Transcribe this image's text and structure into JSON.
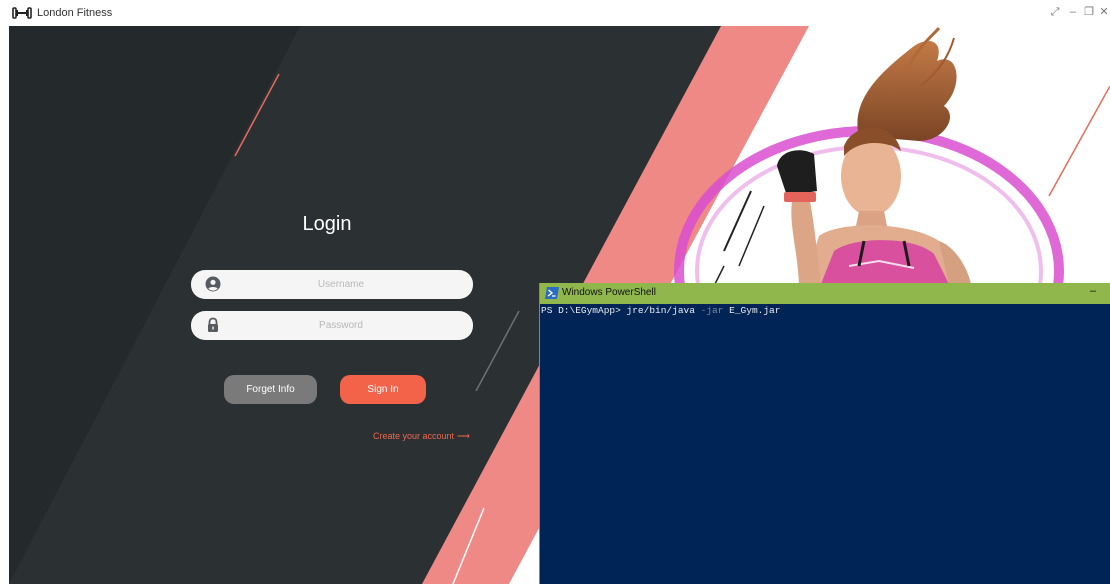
{
  "window": {
    "title": "London Fitness",
    "logo_icon": "dumbbell-icon",
    "controls": [
      {
        "name": "expand-icon",
        "glyph": "⤢"
      },
      {
        "name": "minimize-icon",
        "glyph": "–"
      },
      {
        "name": "restore-icon",
        "glyph": "❐"
      },
      {
        "name": "close-icon",
        "glyph": "✕"
      }
    ]
  },
  "login": {
    "title": "Login",
    "username_placeholder": "Username",
    "password_placeholder": "Password",
    "username_icon": "user-icon",
    "password_icon": "lock-icon",
    "forget_label": "Forget Info",
    "signin_label": "Sign In",
    "create_label": "Create your account",
    "create_arrow": "⟶"
  },
  "colors": {
    "dark_panel": "#2b3033",
    "salmon": "#ee8986",
    "accent": "#f2634a",
    "grey_button": "#7a7a7a",
    "powershell_bg": "#012456",
    "powershell_titlebar": "#8fb74c"
  },
  "powershell": {
    "title": "Windows PowerShell",
    "minimize_glyph": "–",
    "prompt": "PS D:\\EGymApp> jre/bin/java ",
    "flag": "-jar",
    "arg": " E_Gym.jar"
  }
}
